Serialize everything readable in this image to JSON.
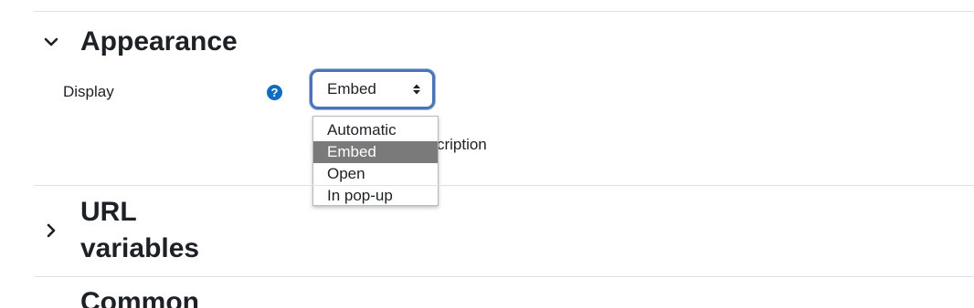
{
  "sections": {
    "appearance": {
      "title": "Appearance",
      "expanded": true
    },
    "url_variables": {
      "title_line1": "URL",
      "title_line2": "variables",
      "expanded": false
    },
    "common": {
      "title": "Common"
    }
  },
  "display_field": {
    "label": "Display",
    "help_icon": "question-circle-icon",
    "selected_value": "Embed",
    "options": [
      "Automatic",
      "Embed",
      "Open",
      "In pop-up"
    ],
    "selected_index": 1
  },
  "hidden_text": "escription",
  "colors": {
    "accent": "#0f6cbf",
    "focus_border": "#4a73b8",
    "selected_option_bg": "#7a7a7a"
  }
}
